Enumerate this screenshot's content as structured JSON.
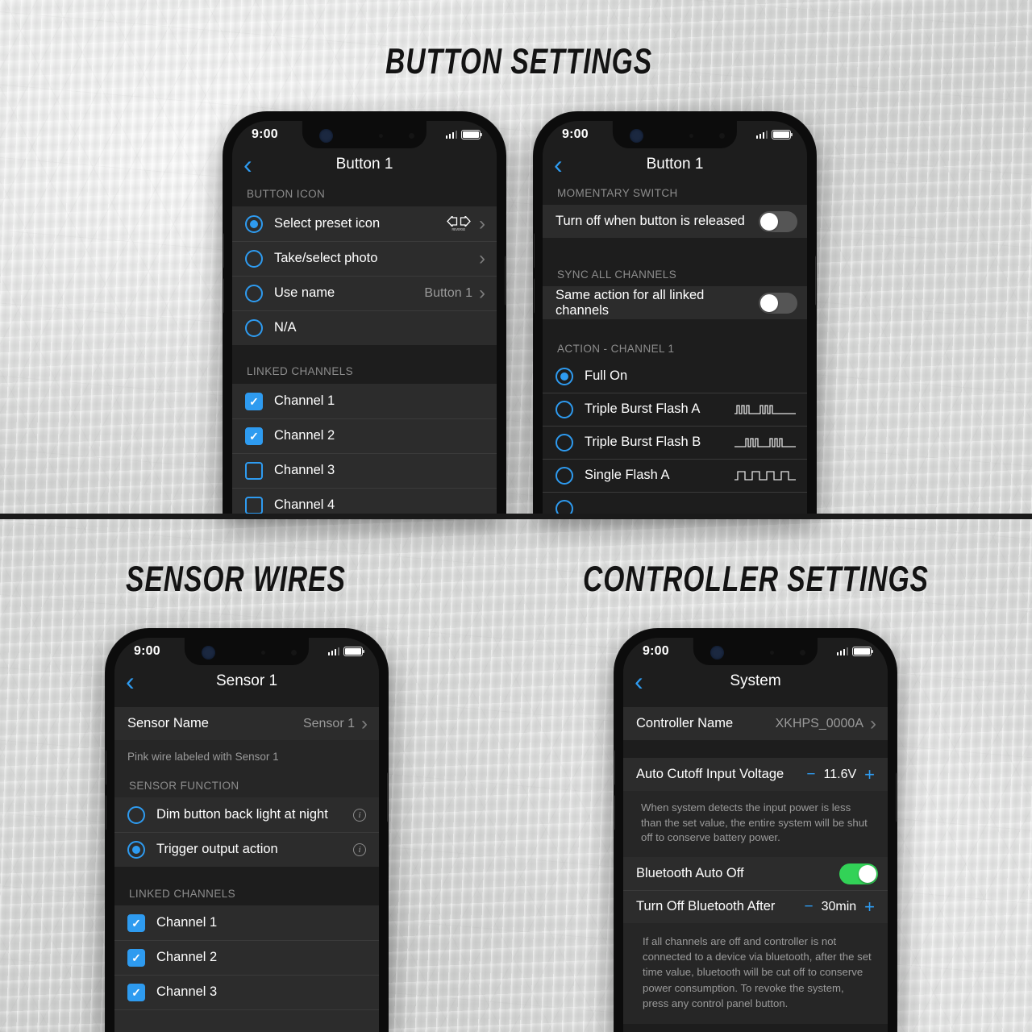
{
  "theme": {
    "accent_blue": "#2e9bf0",
    "toggle_on_green": "#32d257",
    "screen_bg": "#1d1d1d",
    "row_bg": "#2c2c2c",
    "background": "#d8d9d8"
  },
  "sections": {
    "button_settings_title": "BUTTON SETTINGS",
    "sensor_wires_title": "SENSOR WIRES",
    "controller_settings_title": "CONTROLLER SETTINGS"
  },
  "status_bar": {
    "time": "9:00"
  },
  "phone1": {
    "nav": {
      "back": "‹",
      "title": "Button 1"
    },
    "section1_header": "BUTTON ICON",
    "icon_rows": [
      {
        "label": "Select preset icon",
        "selected": true,
        "value": "",
        "preset_icon": "double-arrow-icon",
        "preset_sub": "REVERSE",
        "chevron": "›"
      },
      {
        "label": "Take/select photo",
        "selected": false,
        "value": "",
        "preset_icon": "",
        "preset_sub": "",
        "chevron": "›"
      },
      {
        "label": "Use name",
        "selected": false,
        "value": "Button 1",
        "preset_icon": "",
        "preset_sub": "",
        "chevron": "›"
      },
      {
        "label": "N/A",
        "selected": false,
        "value": "",
        "preset_icon": "",
        "preset_sub": "",
        "chevron": ""
      }
    ],
    "section2_header": "LINKED CHANNELS",
    "channels": [
      {
        "label": "Channel 1",
        "checked": true
      },
      {
        "label": "Channel 2",
        "checked": true
      },
      {
        "label": "Channel 3",
        "checked": false
      },
      {
        "label": "Channel 4",
        "checked": false
      }
    ]
  },
  "phone2": {
    "nav": {
      "back": "‹",
      "title": "Button 1"
    },
    "section1_header": "MOMENTARY SWITCH",
    "momentary_row": {
      "label": "Turn off when button is released",
      "toggle_on": false
    },
    "section2_header": "SYNC ALL CHANNELS",
    "sync_row": {
      "label": "Same action for all linked channels",
      "toggle_on": false
    },
    "section3_header": "ACTION - CHANNEL 1",
    "actions": [
      {
        "label": "Full On",
        "selected": true,
        "wave": ""
      },
      {
        "label": "Triple Burst Flash A",
        "selected": false,
        "wave": "triple-burst-a-waveform"
      },
      {
        "label": "Triple Burst Flash B",
        "selected": false,
        "wave": "triple-burst-b-waveform"
      },
      {
        "label": "Single Flash A",
        "selected": false,
        "wave": "single-flash-a-waveform"
      }
    ]
  },
  "phone3": {
    "nav": {
      "back": "‹",
      "title": "Sensor 1"
    },
    "name_row": {
      "label": "Sensor Name",
      "value": "Sensor 1",
      "chevron": "›"
    },
    "note": "Pink wire labeled with Sensor 1",
    "section_header": "SENSOR FUNCTION",
    "functions": [
      {
        "label": "Dim button back light at night",
        "selected": false,
        "info": "i"
      },
      {
        "label": "Trigger output action",
        "selected": true,
        "info": "i"
      }
    ],
    "section2_header": "LINKED CHANNELS",
    "channels": [
      {
        "label": "Channel 1",
        "checked": true
      },
      {
        "label": "Channel 2",
        "checked": true
      },
      {
        "label": "Channel 3",
        "checked": true
      }
    ]
  },
  "phone4": {
    "nav": {
      "back": "‹",
      "title": "System"
    },
    "controller_row": {
      "label": "Controller Name",
      "value": "XKHPS_0000A",
      "chevron": "›"
    },
    "voltage_row": {
      "label": "Auto Cutoff Input Voltage",
      "minus": "−",
      "value": "11.6V",
      "plus": "+"
    },
    "voltage_note": "When system detects the input power is less than the set value, the entire system will be shut off to conserve battery power.",
    "bluetooth_row": {
      "label": "Bluetooth Auto Off",
      "toggle_on": true
    },
    "timer_row": {
      "label": "Turn Off Bluetooth After",
      "minus": "−",
      "value": "30min",
      "plus": "+"
    },
    "bluetooth_note": "If all channels are off and controller is not connected to a device via bluetooth, after the set time value, bluetooth will be cut off to conserve power consumption. To revoke the system, press any control panel button."
  }
}
